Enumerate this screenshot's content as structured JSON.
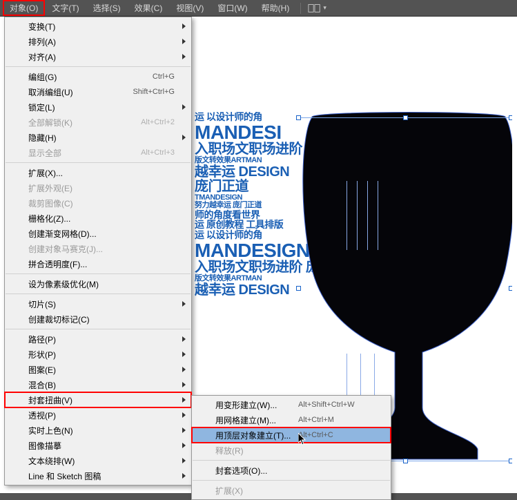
{
  "menubar": {
    "items": [
      {
        "label": "对象(O)",
        "highlight": true
      },
      {
        "label": "文字(T)"
      },
      {
        "label": "选择(S)"
      },
      {
        "label": "效果(C)"
      },
      {
        "label": "视图(V)"
      },
      {
        "label": "窗口(W)"
      },
      {
        "label": "帮助(H)"
      }
    ]
  },
  "object_menu": [
    {
      "label": "变换(T)",
      "submenu": true
    },
    {
      "label": "排列(A)",
      "submenu": true
    },
    {
      "label": "对齐(A)",
      "submenu": true
    },
    {
      "sep": true
    },
    {
      "label": "编组(G)",
      "accel": "Ctrl+G"
    },
    {
      "label": "取消编组(U)",
      "accel": "Shift+Ctrl+G"
    },
    {
      "label": "锁定(L)",
      "submenu": true
    },
    {
      "label": "全部解锁(K)",
      "accel": "Alt+Ctrl+2",
      "disabled": true
    },
    {
      "label": "隐藏(H)",
      "submenu": true
    },
    {
      "label": "显示全部",
      "accel": "Alt+Ctrl+3",
      "disabled": true
    },
    {
      "sep": true
    },
    {
      "label": "扩展(X)..."
    },
    {
      "label": "扩展外观(E)",
      "disabled": true
    },
    {
      "label": "裁剪图像(C)",
      "disabled": true
    },
    {
      "label": "栅格化(Z)..."
    },
    {
      "label": "创建渐变网格(D)..."
    },
    {
      "label": "创建对象马赛克(J)...",
      "disabled": true
    },
    {
      "label": "拼合透明度(F)..."
    },
    {
      "sep": true
    },
    {
      "label": "设为像素级优化(M)"
    },
    {
      "sep": true
    },
    {
      "label": "切片(S)",
      "submenu": true
    },
    {
      "label": "创建裁切标记(C)"
    },
    {
      "sep": true
    },
    {
      "label": "路径(P)",
      "submenu": true
    },
    {
      "label": "形状(P)",
      "submenu": true
    },
    {
      "label": "图案(E)",
      "submenu": true
    },
    {
      "label": "混合(B)",
      "submenu": true
    },
    {
      "label": "封套扭曲(V)",
      "submenu": true,
      "redbox": true
    },
    {
      "label": "透视(P)",
      "submenu": true
    },
    {
      "label": "实时上色(N)",
      "submenu": true
    },
    {
      "label": "图像描摹",
      "submenu": true
    },
    {
      "label": "文本绕排(W)",
      "submenu": true
    },
    {
      "label": "Line 和 Sketch 图稿",
      "submenu": true
    }
  ],
  "envelope_submenu": [
    {
      "label": "用变形建立(W)...",
      "accel": "Alt+Shift+Ctrl+W"
    },
    {
      "label": "用网格建立(M)...",
      "accel": "Alt+Ctrl+M"
    },
    {
      "label": "用顶层对象建立(T)...",
      "accel": "Alt+Ctrl+C",
      "redbox": true,
      "highlight": true
    },
    {
      "label": "释放(R)",
      "disabled": true
    },
    {
      "sep": true
    },
    {
      "label": "封套选项(O)..."
    },
    {
      "sep": true
    },
    {
      "label": "扩展(X)",
      "disabled": true
    }
  ],
  "textcloud": {
    "l1": "运 以设计师的角",
    "l2": "MANDESI",
    "l3": "入职场文职场进阶",
    "l4": "版文转效果ARTMAN",
    "l5": "越幸运 DESIGN",
    "l6": "庞门正道",
    "l7": "TMANDESIGN",
    "l8": "努力越幸运 庞门正道",
    "l9": "师的角度看世界",
    "l10": "运 原创教程 工具排版",
    "l11": "运 以设计师的角",
    "l12": "MANDESIGN",
    "l13": "入职场文职场进阶 庞",
    "l14": "版文转效果ARTMAN",
    "l15": "越幸运 DESIGN"
  }
}
